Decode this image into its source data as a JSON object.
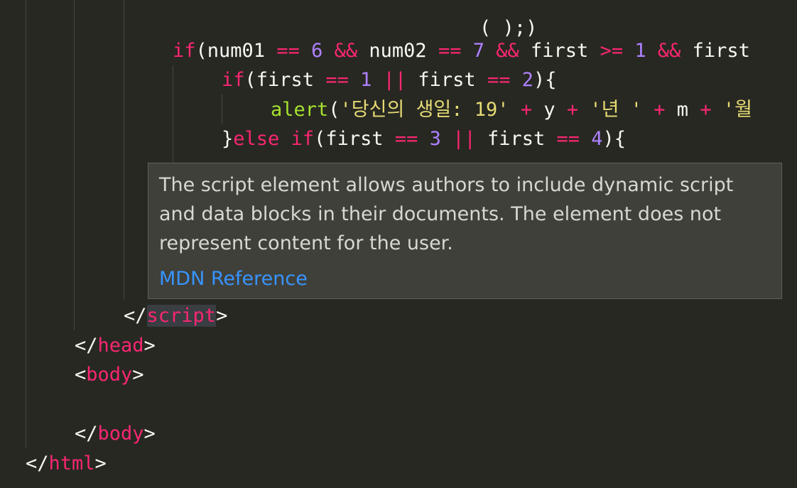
{
  "editor": {
    "lines": [
      {
        "name": "code-line-if-num01",
        "tokens": [
          {
            "t": "if",
            "c": "kw"
          },
          {
            "t": "(num01 ",
            "c": "pl"
          },
          {
            "t": "==",
            "c": "kw"
          },
          {
            "t": " ",
            "c": "pl"
          },
          {
            "t": "6",
            "c": "num"
          },
          {
            "t": " ",
            "c": "pl"
          },
          {
            "t": "&&",
            "c": "kw"
          },
          {
            "t": " num02 ",
            "c": "pl"
          },
          {
            "t": "==",
            "c": "kw"
          },
          {
            "t": " ",
            "c": "pl"
          },
          {
            "t": "7",
            "c": "num"
          },
          {
            "t": " ",
            "c": "pl"
          },
          {
            "t": "&&",
            "c": "kw"
          },
          {
            "t": " first ",
            "c": "pl"
          },
          {
            "t": ">=",
            "c": "kw"
          },
          {
            "t": " ",
            "c": "pl"
          },
          {
            "t": "1",
            "c": "num"
          },
          {
            "t": " ",
            "c": "pl"
          },
          {
            "t": "&&",
            "c": "kw"
          },
          {
            "t": " first",
            "c": "pl"
          }
        ]
      },
      {
        "name": "code-line-if-first",
        "tokens": [
          {
            "t": "if",
            "c": "kw"
          },
          {
            "t": "(first ",
            "c": "pl"
          },
          {
            "t": "==",
            "c": "kw"
          },
          {
            "t": " ",
            "c": "pl"
          },
          {
            "t": "1",
            "c": "num"
          },
          {
            "t": " ",
            "c": "pl"
          },
          {
            "t": "||",
            "c": "kw"
          },
          {
            "t": " first ",
            "c": "pl"
          },
          {
            "t": "==",
            "c": "kw"
          },
          {
            "t": " ",
            "c": "pl"
          },
          {
            "t": "2",
            "c": "num"
          },
          {
            "t": "){",
            "c": "pl"
          }
        ]
      },
      {
        "name": "code-line-alert",
        "tokens": [
          {
            "t": "alert",
            "c": "fn"
          },
          {
            "t": "(",
            "c": "pl"
          },
          {
            "t": "'당신의 생일: 19'",
            "c": "str"
          },
          {
            "t": " ",
            "c": "pl"
          },
          {
            "t": "+",
            "c": "kw"
          },
          {
            "t": " y ",
            "c": "pl"
          },
          {
            "t": "+",
            "c": "kw"
          },
          {
            "t": " ",
            "c": "pl"
          },
          {
            "t": "'년 '",
            "c": "str"
          },
          {
            "t": " ",
            "c": "pl"
          },
          {
            "t": "+",
            "c": "kw"
          },
          {
            "t": " m ",
            "c": "pl"
          },
          {
            "t": "+",
            "c": "kw"
          },
          {
            "t": " ",
            "c": "pl"
          },
          {
            "t": "'월",
            "c": "str"
          }
        ]
      },
      {
        "name": "code-line-else-if",
        "tokens": [
          {
            "t": "}",
            "c": "pl"
          },
          {
            "t": "else",
            "c": "kw"
          },
          {
            "t": " ",
            "c": "pl"
          },
          {
            "t": "if",
            "c": "kw"
          },
          {
            "t": "(first ",
            "c": "pl"
          },
          {
            "t": "==",
            "c": "kw"
          },
          {
            "t": " ",
            "c": "pl"
          },
          {
            "t": "3",
            "c": "num"
          },
          {
            "t": " ",
            "c": "pl"
          },
          {
            "t": "||",
            "c": "kw"
          },
          {
            "t": " first ",
            "c": "pl"
          },
          {
            "t": "==",
            "c": "kw"
          },
          {
            "t": " ",
            "c": "pl"
          },
          {
            "t": "4",
            "c": "num"
          },
          {
            "t": "){",
            "c": "pl"
          }
        ]
      },
      {
        "name": "code-line-script-close",
        "tokens": [
          {
            "t": "</",
            "c": "pl"
          },
          {
            "t": "script",
            "c": "tag",
            "hover": true
          },
          {
            "t": ">",
            "c": "pl"
          }
        ]
      },
      {
        "name": "code-line-head-close",
        "tokens": [
          {
            "t": "</",
            "c": "pl"
          },
          {
            "t": "head",
            "c": "tag"
          },
          {
            "t": ">",
            "c": "pl"
          }
        ]
      },
      {
        "name": "code-line-body-open",
        "tokens": [
          {
            "t": "<",
            "c": "pl"
          },
          {
            "t": "body",
            "c": "tag"
          },
          {
            "t": ">",
            "c": "pl"
          }
        ]
      },
      {
        "name": "code-line-body-close",
        "tokens": [
          {
            "t": "</",
            "c": "pl"
          },
          {
            "t": "body",
            "c": "tag"
          },
          {
            "t": ">",
            "c": "pl"
          }
        ]
      },
      {
        "name": "code-line-html-close",
        "tokens": [
          {
            "t": "</",
            "c": "pl"
          },
          {
            "t": "html",
            "c": "tag"
          },
          {
            "t": ">",
            "c": "pl"
          }
        ]
      }
    ]
  },
  "hover": {
    "description": "The script element allows authors to include dynamic script and data blocks in their documents. The element does not represent content for the user.",
    "link_label": "MDN Reference"
  },
  "colors": {
    "background": "#272822",
    "keyword": "#f92672",
    "number": "#ae81ff",
    "function": "#a6e22e",
    "string": "#e6db74",
    "plain": "#f8f8f2",
    "link": "#3794ff"
  }
}
